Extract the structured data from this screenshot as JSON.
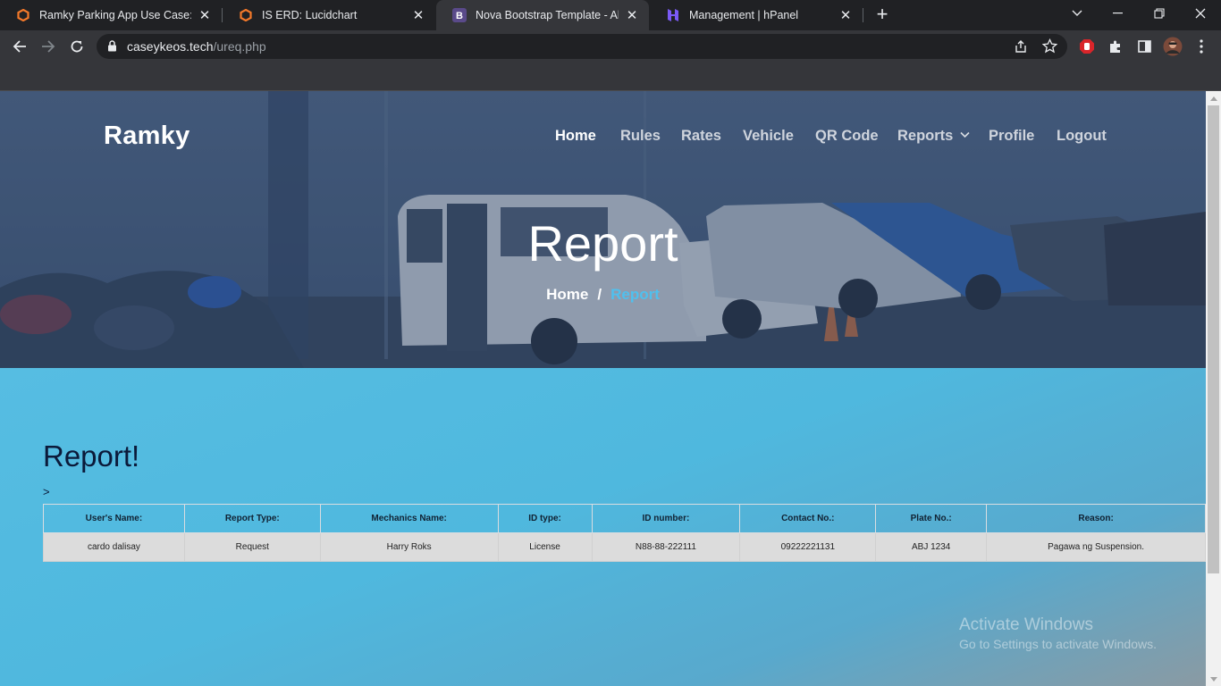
{
  "browser": {
    "tabs": [
      {
        "title": "Ramky Parking App Use Case: Lu",
        "icon": "lucidchart-icon",
        "active": false
      },
      {
        "title": "IS ERD: Lucidchart",
        "icon": "lucidchart-icon",
        "active": false
      },
      {
        "title": "Nova Bootstrap Template - Abou",
        "icon": "bootstrap-icon",
        "active": true
      },
      {
        "title": "Management | hPanel",
        "icon": "hostinger-icon",
        "active": false
      }
    ],
    "address": {
      "domain": "caseykeos.tech",
      "path": "/ureq.php"
    }
  },
  "site": {
    "brand": "Ramky",
    "nav": [
      {
        "label": "Home",
        "active": true
      },
      {
        "label": "Rules"
      },
      {
        "label": "Rates"
      },
      {
        "label": "Vehicle"
      },
      {
        "label": "QR Code"
      },
      {
        "label": "Reports",
        "dropdown": true
      },
      {
        "label": "Profile"
      },
      {
        "label": "Logout"
      }
    ],
    "hero": {
      "title": "Report",
      "breadcrumb": {
        "home": "Home",
        "separator": "/",
        "current": "Report"
      }
    }
  },
  "report": {
    "heading": "Report!",
    "stray_text": ">",
    "columns": [
      "User's Name:",
      "Report Type:",
      "Mechanics Name:",
      "ID type:",
      "ID number:",
      "Contact No.:",
      "Plate No.:",
      "Reason:"
    ],
    "rows": [
      [
        "cardo dalisay",
        "Request",
        "Harry Roks",
        "License",
        "N88-88-222111",
        "09222221131",
        "ABJ 1234",
        "Pagawa ng Suspension."
      ]
    ]
  },
  "watermark": {
    "line1": "Activate Windows",
    "line2": "Go to Settings to activate Windows."
  },
  "colors": {
    "accent": "#4fc0ee",
    "tabbar": "#202124",
    "toolbar": "#35363a"
  }
}
